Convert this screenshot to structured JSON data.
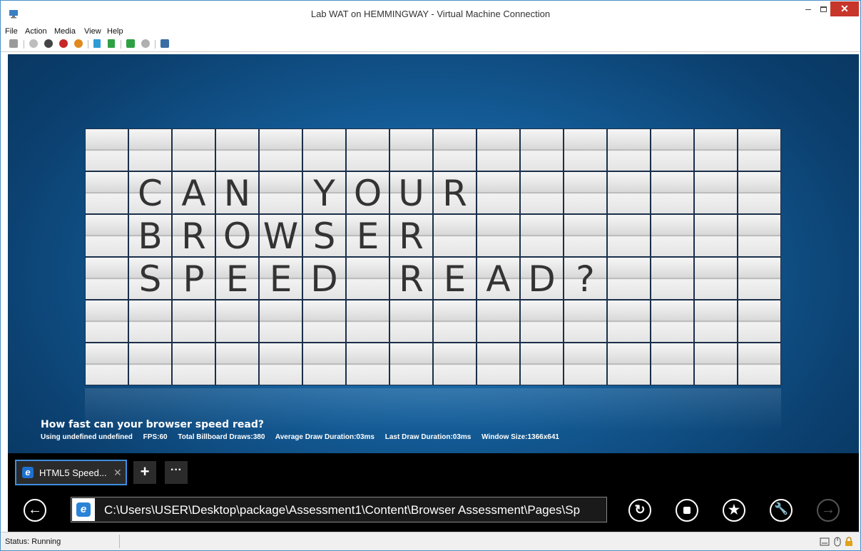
{
  "window": {
    "title": "Lab WAT on HEMMINGWAY - Virtual Machine Connection",
    "close_glyph": "✕",
    "minimize_glyph": "‒"
  },
  "menu": [
    "File",
    "Action",
    "Media",
    "View",
    "Help"
  ],
  "toolbar_icons": [
    {
      "name": "ctrl-alt-del-icon",
      "color": "#9a9a9a"
    },
    {
      "name": "start-icon",
      "color": "#bdbdbd"
    },
    {
      "name": "turn-off-icon",
      "color": "#444444"
    },
    {
      "name": "shut-down-icon",
      "color": "#c62828"
    },
    {
      "name": "save-icon",
      "color": "#e08a1e"
    },
    {
      "name": "pause-icon",
      "color": "#2e9bd6"
    },
    {
      "name": "reset-icon",
      "color": "#2ea043"
    },
    {
      "name": "snapshot-icon",
      "color": "#2ea043"
    },
    {
      "name": "revert-icon",
      "color": "#b0b0b0"
    },
    {
      "name": "enhanced-session-icon",
      "color": "#3a6ea5"
    }
  ],
  "billboard": {
    "rows": [
      "",
      " CAN YOUR",
      " BROWSER",
      " SPEED READ?",
      "",
      ""
    ]
  },
  "page": {
    "headline": "How fast can your browser speed read?",
    "stats": {
      "using": "Using undefined undefined",
      "fps": "FPS:60",
      "total_draws": "Total Billboard Draws:380",
      "avg_duration": "Average Draw Duration:03ms",
      "last_duration": "Last Draw Duration:03ms",
      "window_size": "Window Size:1366x641"
    }
  },
  "browser": {
    "tab_title": "HTML5 Speed...",
    "tab_close": "✕",
    "new_tab": "+",
    "more_tabs": "···",
    "address": "C:\\Users\\USER\\Desktop\\package\\Assessment1\\Content\\Browser Assessment\\Pages\\Sp",
    "ie_glyph": "e",
    "back_glyph": "←",
    "forward_glyph": "→",
    "refresh_glyph": "↻",
    "favorites_glyph": "★",
    "tools_glyph": "🔧"
  },
  "status": {
    "text": "Status: Running"
  }
}
